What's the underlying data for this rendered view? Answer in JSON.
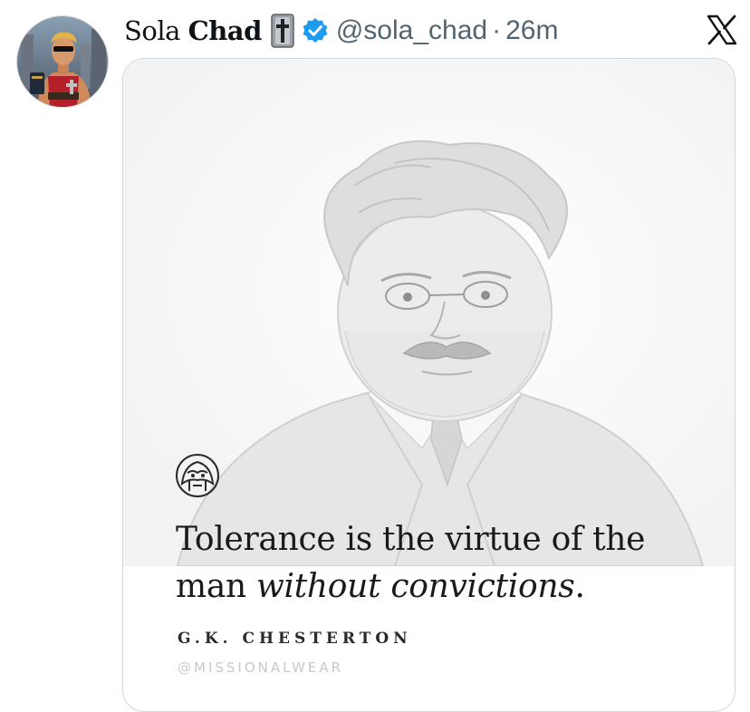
{
  "tweet": {
    "display_name_plain": "Sola ",
    "display_name_bold": "Chad",
    "name_emoji": "cross-bookmark-icon",
    "verified": "verified-badge-icon",
    "handle": "@sola_chad",
    "separator": "·",
    "time": "26m",
    "platform_icon": "x-logo-icon",
    "colors": {
      "verified": "#1d9bf0",
      "handle": "#536471",
      "text": "#0f1419"
    }
  },
  "media": {
    "quote_part1": "Tolerance is the virtue of the man ",
    "quote_emphasis": "without convictions",
    "quote_end": ".",
    "author": "G.K. CHESTERTON",
    "watermark": "@MISSIONALWEAR"
  }
}
